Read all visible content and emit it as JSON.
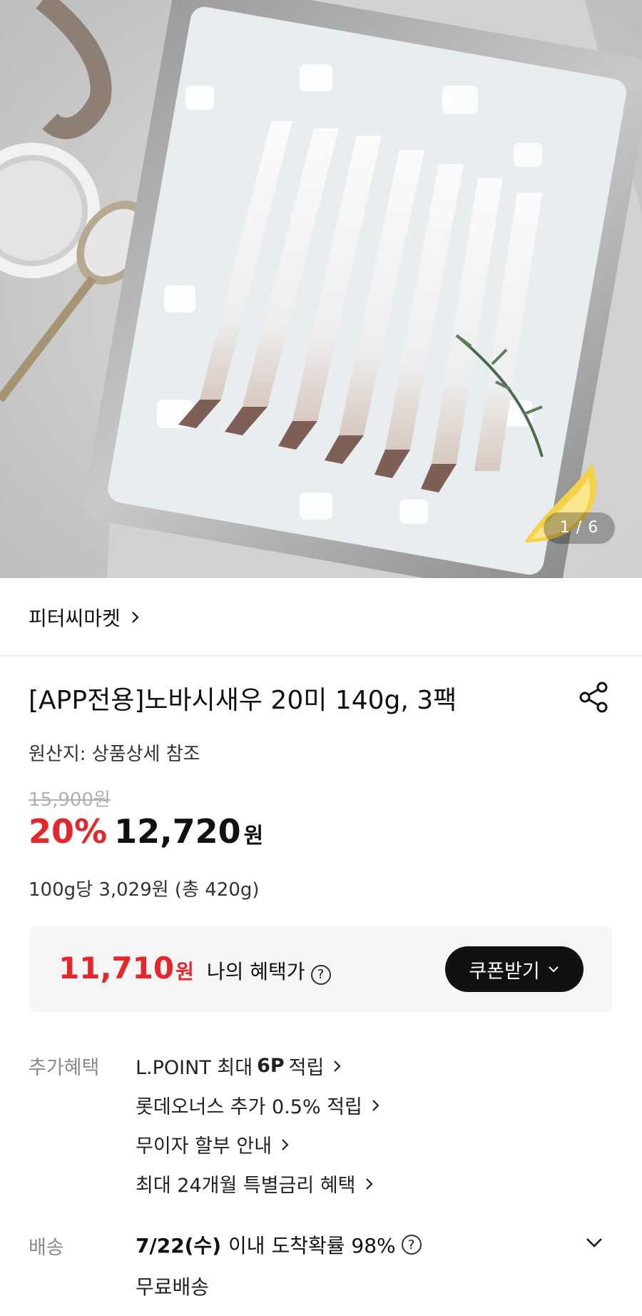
{
  "gallery": {
    "counter": "1 / 6"
  },
  "seller": {
    "name": "피터씨마켓"
  },
  "product": {
    "title": "[APP전용]노바시새우 20미 140g, 3팩",
    "origin": "원산지: 상품상세 참조",
    "original_price": "15,900원",
    "discount_rate": "20%",
    "price": "12,720",
    "price_unit": "원",
    "unit_price": "100g당 3,029원 (총 420g)"
  },
  "benefit_price": {
    "amount": "11,710",
    "unit": "원",
    "label": "나의 혜택가",
    "help": "?",
    "coupon_button": "쿠폰받기"
  },
  "extra_benefits": {
    "label": "추가혜택",
    "items": [
      {
        "prefix": "L.POINT 최대",
        "bold": "6P",
        "suffix": "적립"
      },
      {
        "text": "롯데오너스 추가 0.5% 적립"
      },
      {
        "text": "무이자 할부 안내"
      },
      {
        "text": "최대 24개월 특별금리 혜택"
      }
    ]
  },
  "delivery": {
    "label": "배송",
    "date": "7/22(수)",
    "text": "이내 도착확률 98%",
    "help": "?",
    "fee": "무료배송"
  },
  "colors": {
    "accent_red": "#e5262a",
    "dark_button": "#111111"
  },
  "icons": [
    "share-icon",
    "chevron-right-icon",
    "chevron-down-icon",
    "help-circle-icon"
  ]
}
